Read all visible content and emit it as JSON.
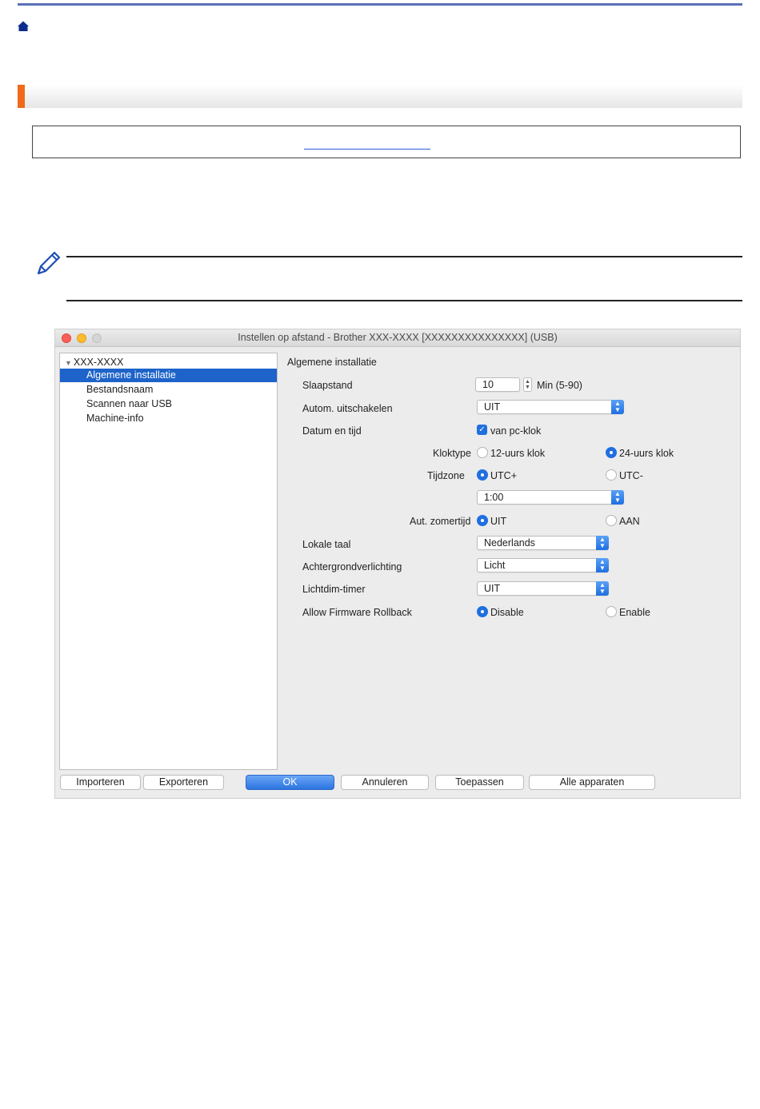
{
  "window": {
    "title": "Instellen op afstand - Brother XXX-XXXX [XXXXXXXXXXXXXXX]  (USB)"
  },
  "tree": {
    "root": "XXX-XXXX",
    "items": [
      "Algemene installatie",
      "Bestandsnaam",
      "Scannen naar USB",
      "Machine-info"
    ],
    "selected_index": 0
  },
  "panel": {
    "title": "Algemene installatie",
    "sleep": {
      "label": "Slaapstand",
      "value": "10",
      "unit": "Min (5-90)"
    },
    "auto_off": {
      "label": "Autom. uitschakelen",
      "value": "UIT"
    },
    "datetime": {
      "label": "Datum en tijd",
      "checkbox_label": "van pc-klok",
      "checked": true
    },
    "clock_type": {
      "label": "Kloktype",
      "option1": "12-uurs klok",
      "option2": "24-uurs klok",
      "selected": "24-uurs klok"
    },
    "timezone": {
      "label": "Tijdzone",
      "option1": "UTC+",
      "option2": "UTC-",
      "selected": "UTC+",
      "offset": "1:00"
    },
    "dst": {
      "label": "Aut. zomertijd",
      "option1": "UIT",
      "option2": "AAN",
      "selected": "UIT"
    },
    "language": {
      "label": "Lokale taal",
      "value": "Nederlands"
    },
    "backlight": {
      "label": "Achtergrondverlichting",
      "value": "Licht"
    },
    "dim_timer": {
      "label": "Lichtdim-timer",
      "value": "UIT"
    },
    "firmware_rollback": {
      "label": "Allow Firmware Rollback",
      "option1": "Disable",
      "option2": "Enable",
      "selected": "Disable"
    }
  },
  "buttons": {
    "import": "Importeren",
    "export": "Exporteren",
    "ok": "OK",
    "cancel": "Annuleren",
    "apply": "Toepassen",
    "all_devices": "Alle apparaten"
  },
  "colors": {
    "accent": "#1f6fe0",
    "section_accent": "#f06a1a",
    "top_bar": "#5b6fb8"
  }
}
